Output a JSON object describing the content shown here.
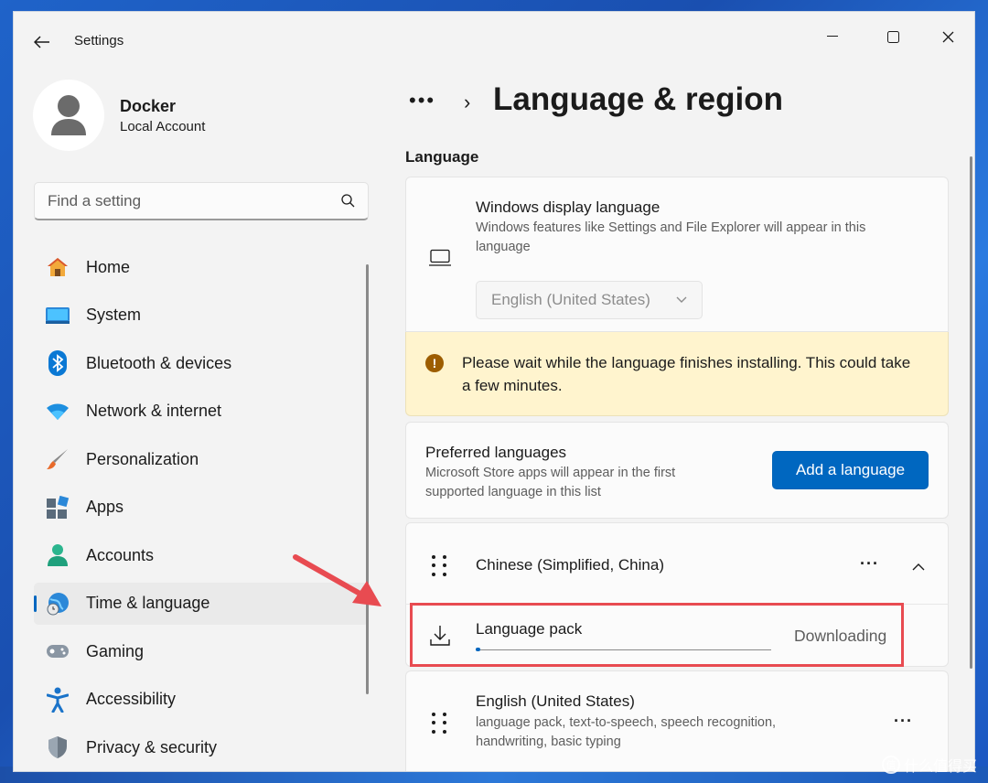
{
  "window": {
    "app_title": "Settings"
  },
  "profile": {
    "name": "Docker",
    "account_type": "Local Account"
  },
  "search": {
    "placeholder": "Find a setting"
  },
  "sidebar": {
    "items": [
      {
        "label": "Home",
        "icon": "home-icon"
      },
      {
        "label": "System",
        "icon": "system-icon"
      },
      {
        "label": "Bluetooth & devices",
        "icon": "bluetooth-icon"
      },
      {
        "label": "Network & internet",
        "icon": "wifi-icon"
      },
      {
        "label": "Personalization",
        "icon": "brush-icon"
      },
      {
        "label": "Apps",
        "icon": "apps-icon"
      },
      {
        "label": "Accounts",
        "icon": "person-icon"
      },
      {
        "label": "Time & language",
        "icon": "globe-clock-icon",
        "active": true
      },
      {
        "label": "Gaming",
        "icon": "gamepad-icon"
      },
      {
        "label": "Accessibility",
        "icon": "accessibility-icon"
      },
      {
        "label": "Privacy & security",
        "icon": "shield-icon"
      }
    ]
  },
  "header": {
    "breadcrumb_more": "•••",
    "title": "Language & region"
  },
  "language_section": {
    "heading": "Language",
    "display_language": {
      "title": "Windows display language",
      "description": "Windows features like Settings and File Explorer will appear in this language",
      "selected": "English (United States)"
    },
    "warning": {
      "text": "Please wait while the language finishes installing. This could take a few minutes."
    },
    "preferred": {
      "title": "Preferred languages",
      "description": "Microsoft Store apps will appear in the first supported language in this list",
      "add_button": "Add a language"
    },
    "languages": [
      {
        "name": "Chinese (Simplified, China)",
        "expanded": true,
        "pack": {
          "label": "Language pack",
          "status": "Downloading",
          "progress": 0.01
        }
      },
      {
        "name": "English (United States)",
        "features": "language pack, text-to-speech, speech recognition, handwriting, basic typing"
      }
    ]
  },
  "watermark": {
    "text": "什么值得买",
    "logo": "值"
  },
  "colors": {
    "accent": "#0067c0",
    "warning_bg": "#fff4ce",
    "annotation": "#e84b51"
  }
}
